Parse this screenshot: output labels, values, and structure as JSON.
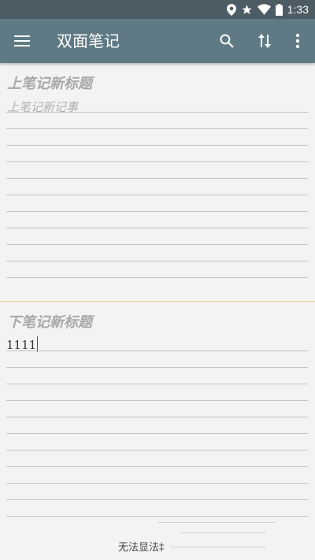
{
  "status_bar": {
    "time": "1:33",
    "icons": [
      "location-icon",
      "star-icon",
      "wifi-icon",
      "battery-icon"
    ]
  },
  "app_bar": {
    "title": "双面笔记",
    "menu_icon": "hamburger-menu-icon",
    "actions": [
      "search-icon",
      "swap-vertical-icon",
      "more-vert-icon"
    ]
  },
  "top_note": {
    "title": "上笔记新标题",
    "body_placeholder": "上笔记新记事"
  },
  "bottom_note": {
    "title": "下笔记新标题",
    "body": "1111"
  },
  "footer": {
    "partial_text": "无法显法‡"
  },
  "colors": {
    "status_bar": "#4d5c64",
    "app_bar": "#5f7a84",
    "background": "#f3f3f3",
    "divider": "#f0c792",
    "rule": "#c4c4c4"
  }
}
